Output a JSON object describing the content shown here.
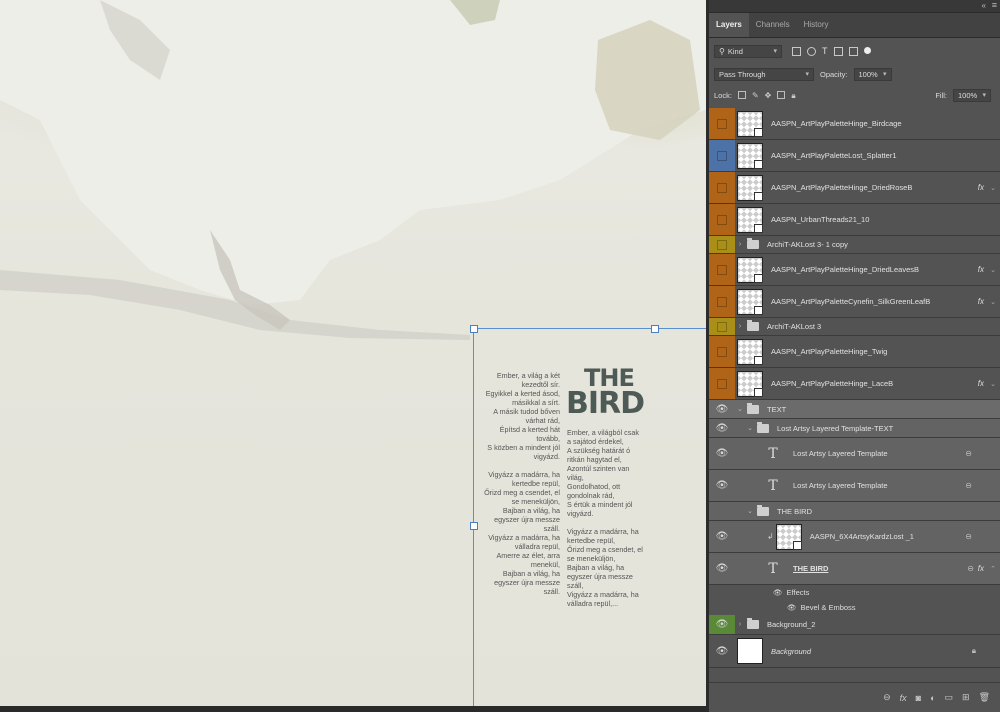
{
  "panel": {
    "tabs": [
      "Layers",
      "Channels",
      "History"
    ],
    "filter": {
      "kind_label": "Kind"
    },
    "blend_mode": "Pass Through",
    "opacity_label": "Opacity:",
    "opacity_value": "100%",
    "lock_label": "Lock:",
    "fill_label": "Fill:",
    "fill_value": "100%"
  },
  "colors": {
    "orange": "#b06417",
    "blue": "#4c72a8",
    "yellow": "#a98f18",
    "green": "#5a8a38"
  },
  "layers": [
    {
      "name": "AASPN_ArtPlayPaletteHinge_Birdcage",
      "color": "orange"
    },
    {
      "name": "AASPN_ArtPlayPaletteLost_Splatter1",
      "color": "blue"
    },
    {
      "name": "AASPN_ArtPlayPaletteHinge_DriedRoseB",
      "color": "orange",
      "fx": "fx"
    },
    {
      "name": "AASPN_UrbanThreads21_10",
      "color": "orange"
    },
    {
      "name": "ArchiT-AKLost 3- 1 copy",
      "color": "yellow",
      "group": true
    },
    {
      "name": "AASPN_ArtPlayPaletteHinge_DriedLeavesB",
      "color": "orange",
      "fx": "fx"
    },
    {
      "name": "AASPN_ArtPlayPaletteCynefin_SilkGreenLeafB",
      "color": "orange",
      "fx": "fx"
    },
    {
      "name": "ArchiT-AKLost 3",
      "color": "yellow",
      "group": true
    },
    {
      "name": "AASPN_ArtPlayPaletteHinge_Twig",
      "color": "orange"
    },
    {
      "name": "AASPN_ArtPlayPaletteHinge_LaceB",
      "color": "orange",
      "fx": "fx"
    }
  ],
  "text_group": {
    "name": "TEXT",
    "sub_group": "Lost Artsy Layered Template-TEXT",
    "text_layer_1": "Lost Artsy Layered Template",
    "text_layer_2": "Lost Artsy Layered Template",
    "bird_group": "THE BIRD",
    "clip_layer": "AASPN_6X4ArtsyKardzLost _1",
    "bird_text_layer": "THE BIRD",
    "effects_label": "Effects",
    "effect_item": "Bevel & Emboss"
  },
  "background_group": "Background_2",
  "background_layer": "Background",
  "canvas": {
    "title_line1": "THE",
    "title_line2": "BIRD",
    "poem_left": [
      "Ember, a világ a két\nkezedtől sír.\nEgyikkel a kerted ásod,\nmásikkal a sírt.\nA másik tudod bőven\nvárhat rád,\nÉpítsd a kerted hát\ntovább,\nS közben a mindent jól\nvigyázd.",
      "Vigyázz a madárra, ha\nkertedbe repül,\nŐrizd meg a csendet, el\nse meneküljön,\nBajban a világ, ha\negyszer újra messze\nszáll.\nVigyázz a madárra, ha\nválladra repül,\nAmerre az élet, arra\nmenekül,\nBajban a világ, ha\negyszer újra messze\nszáll."
    ],
    "poem_right": [
      "Ember, a világból csak\na sajátod érdekel,\nA szükség határát ó\nritkán hagytad el,\nAzontúl szinten van\nvilág,\nGondolhatod, ott\ngondolnak rád,\nS értük a mindent jól\nvigyázd.",
      "Vigyázz a madárra, ha\nkertedbe repül,\nŐrizd meg a csendet, el\nse meneküljön,\nBajban a világ, ha\negyszer újra messze\nszáll,\nVigyázz a madárra, ha\nválladra repül,..."
    ]
  }
}
